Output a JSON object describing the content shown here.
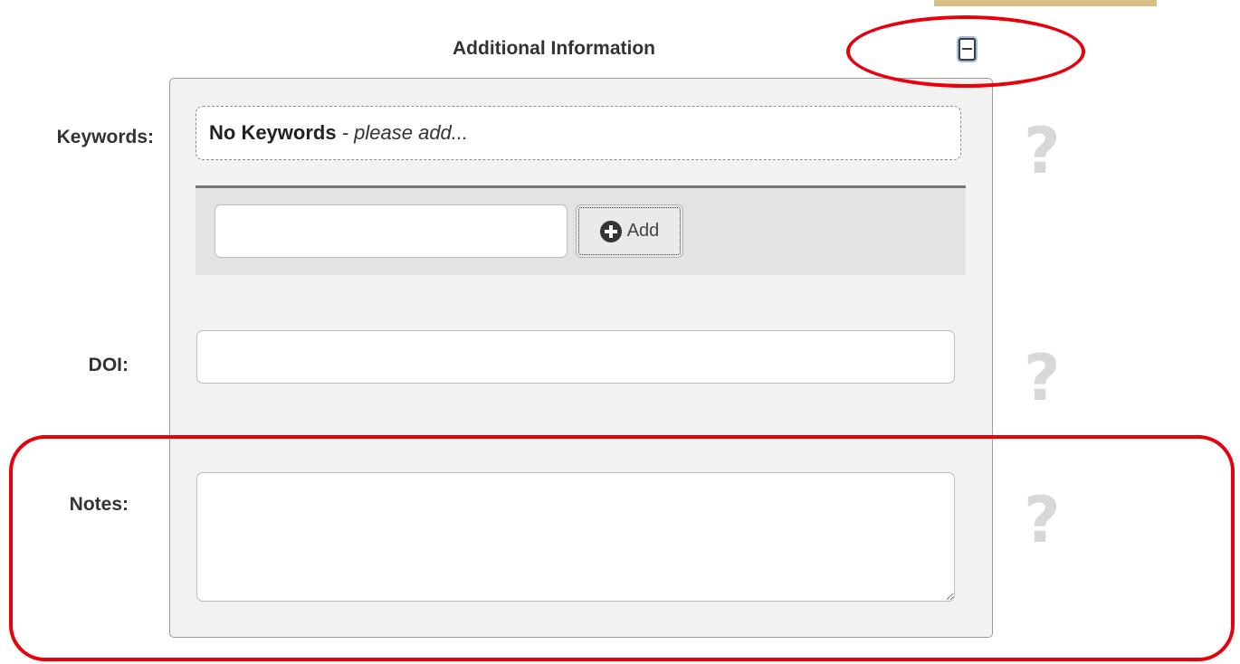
{
  "section": {
    "title": "Additional Information"
  },
  "keywords": {
    "label": "Keywords:",
    "empty_strong": "No Keywords",
    "empty_hint": " - please add...",
    "input_value": "",
    "add_label": "Add"
  },
  "doi": {
    "label": "DOI:",
    "value": ""
  },
  "notes": {
    "label": "Notes:",
    "value": ""
  },
  "help": {
    "glyph": "?"
  },
  "icons": {
    "collapse": "collapse-minus-icon",
    "add": "plus-circle-icon",
    "help": "question-mark-icon"
  },
  "colors": {
    "annotation": "#e8000b",
    "panel_bg": "#f2f2f2",
    "help_glyph": "#d8d8d8",
    "tab_strip": "#d9bf86"
  }
}
